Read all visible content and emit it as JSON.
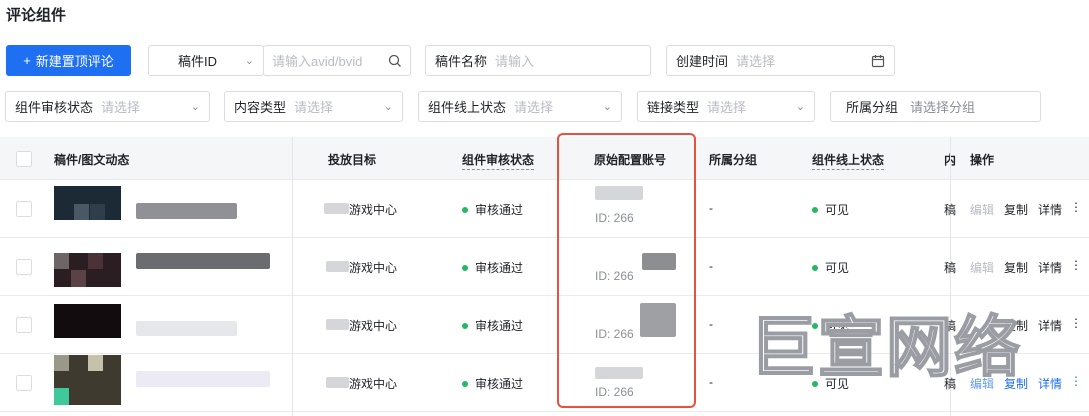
{
  "page": {
    "title": "评论组件"
  },
  "toolbar": {
    "new_button": "新建置顶评论",
    "manuscript_type": "稿件ID",
    "manuscript_placeholder": "请输入avid/bvid",
    "name_label": "稿件名称",
    "name_placeholder": "请输入",
    "created_label": "创建时间",
    "created_placeholder": "请选择"
  },
  "filters": [
    {
      "label": "组件审核状态",
      "placeholder": "请选择"
    },
    {
      "label": "内容类型",
      "placeholder": "请选择"
    },
    {
      "label": "组件线上状态",
      "placeholder": "请选择"
    },
    {
      "label": "链接类型",
      "placeholder": "请选择"
    },
    {
      "label": "所属分组",
      "placeholder": "请选择分组"
    }
  ],
  "table": {
    "columns": [
      "稿件/图文动态",
      "投放目标",
      "组件审核状态",
      "原始配置账号",
      "所属分组",
      "组件线上状态",
      "内",
      "操作"
    ],
    "rows": [
      {
        "target": "游戏中心",
        "audit": "审核通过",
        "account_id": "ID: 266",
        "group": "-",
        "online": "可见",
        "content": "稿"
      },
      {
        "target": "游戏中心",
        "audit": "审核通过",
        "account_id": "ID: 266",
        "group": "-",
        "online": "可见",
        "content": "稿"
      },
      {
        "target": "游戏中心",
        "audit": "审核通过",
        "account_id": "ID: 266",
        "group": "-",
        "online": "可见",
        "content": "稿"
      },
      {
        "target": "游戏中心",
        "audit": "审核通过",
        "account_id": "ID: 266",
        "group": "-",
        "online": "可见",
        "content": "稿"
      }
    ],
    "actions": {
      "edit": "编辑",
      "copy": "复制",
      "detail": "详情"
    }
  },
  "watermark": "巨宣网络",
  "colors": {
    "primary": "#1f6ff2",
    "success": "#25b864",
    "highlight": "#e8503f"
  }
}
